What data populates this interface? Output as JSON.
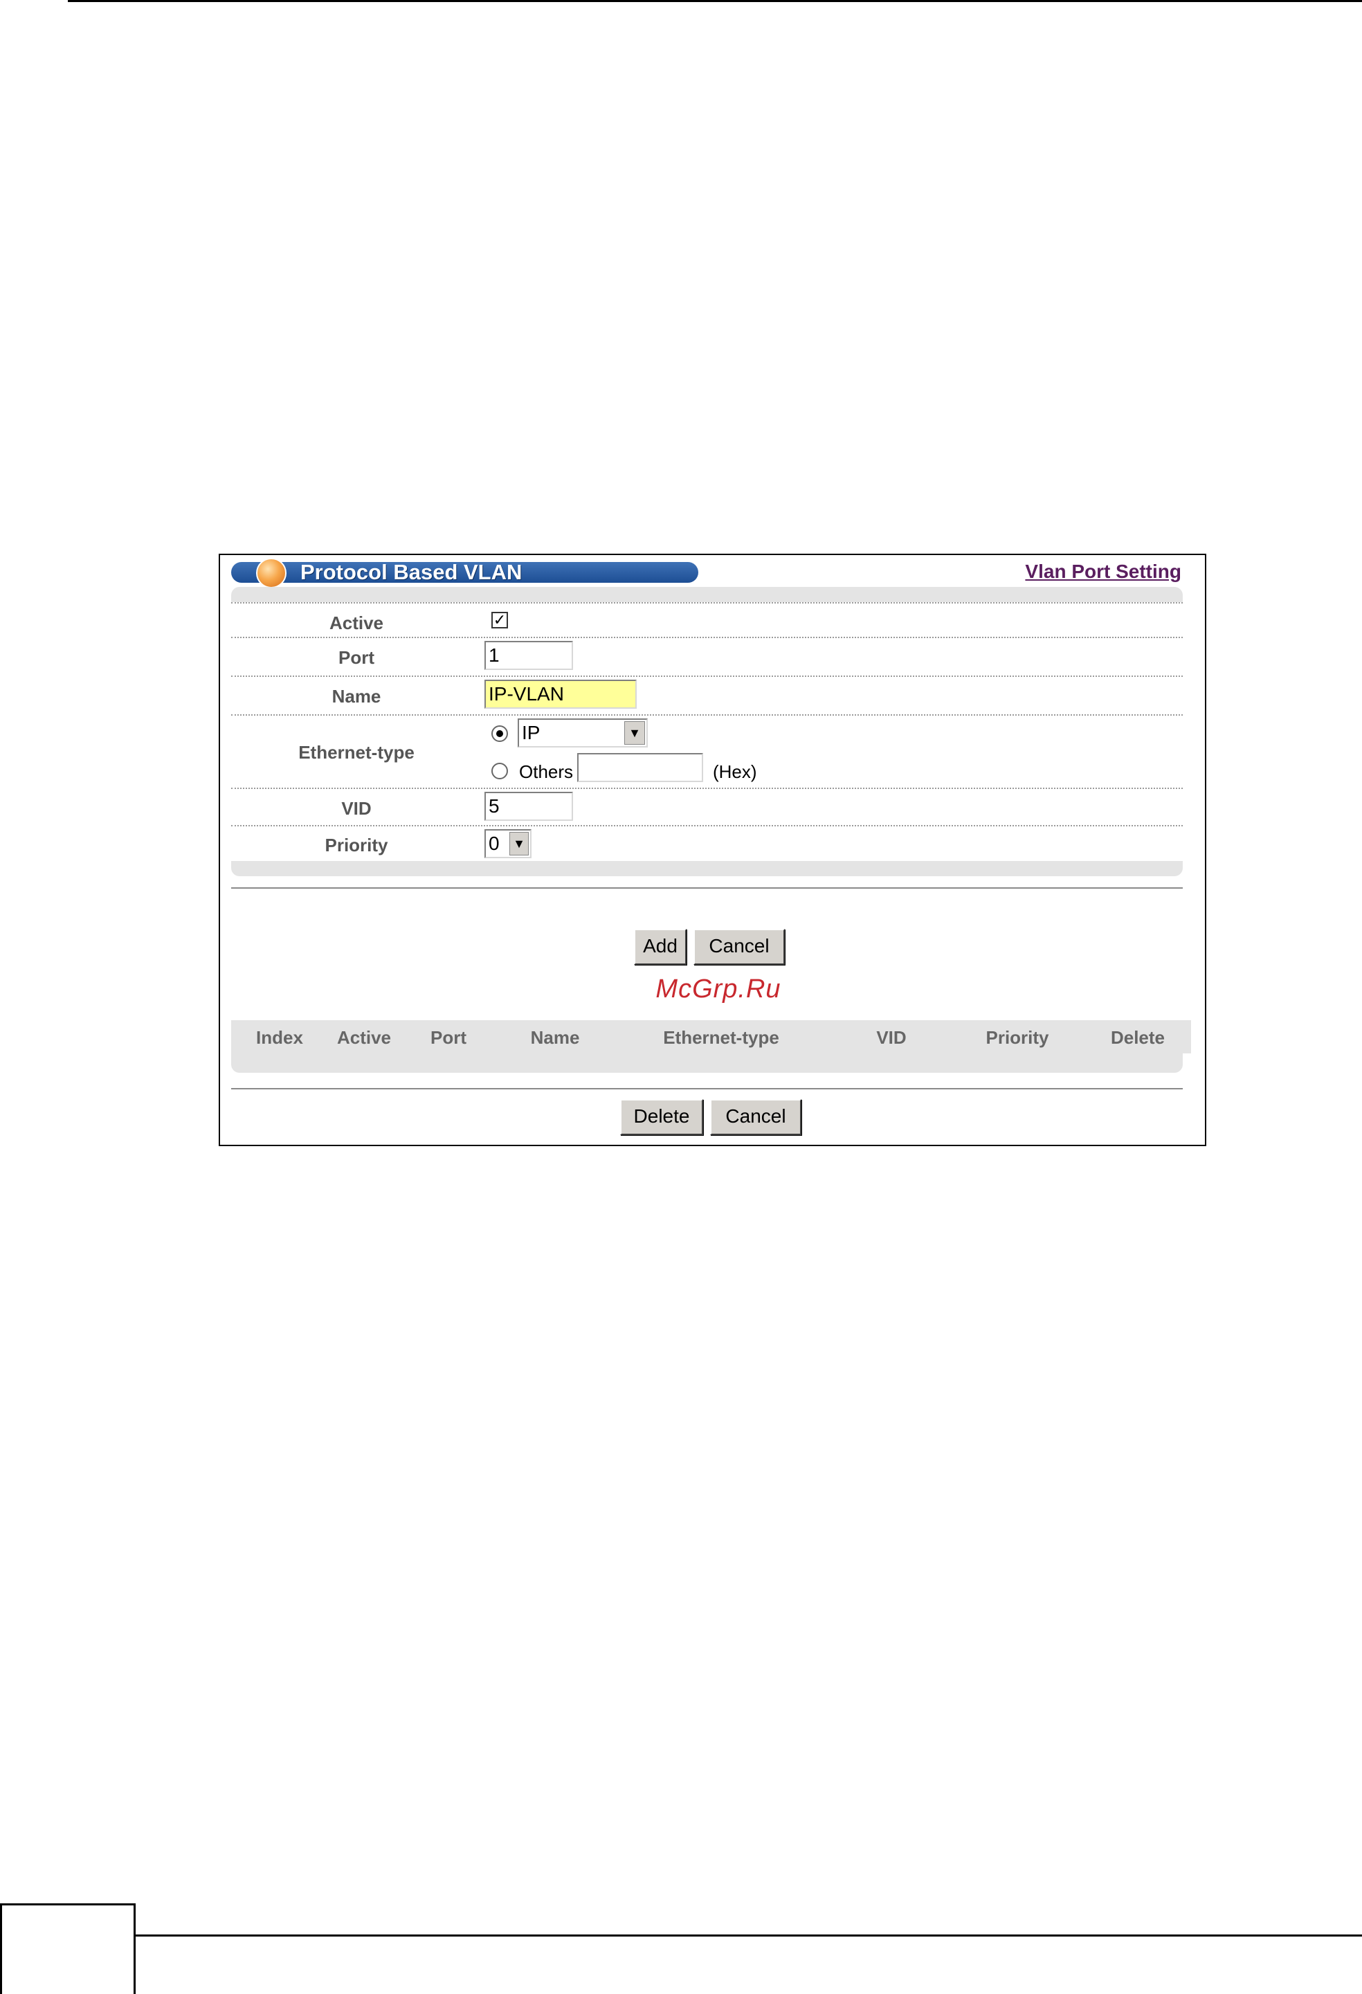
{
  "panel": {
    "title": "Protocol Based VLAN",
    "link": "Vlan Port Setting"
  },
  "form": {
    "active_label": "Active",
    "active_checked": true,
    "port_label": "Port",
    "port_value": "1",
    "name_label": "Name",
    "name_value": "IP-VLAN",
    "ethertype_label": "Ethernet-type",
    "ethertype_selected": "IP",
    "others_label": "Others",
    "others_value": "",
    "hex_label": "(Hex)",
    "vid_label": "VID",
    "vid_value": "5",
    "priority_label": "Priority",
    "priority_selected": "0"
  },
  "buttons": {
    "add": "Add",
    "cancel": "Cancel",
    "delete": "Delete",
    "cancel2": "Cancel"
  },
  "watermark": "McGrp.Ru",
  "table": {
    "columns": [
      "Index",
      "Active",
      "Port",
      "Name",
      "Ethernet-type",
      "VID",
      "Priority",
      "Delete"
    ]
  },
  "colors": {
    "title_bar": "#1d4e94",
    "link": "#5a1e5f",
    "name_field_bg": "#ffff99",
    "watermark": "#c8282e"
  }
}
